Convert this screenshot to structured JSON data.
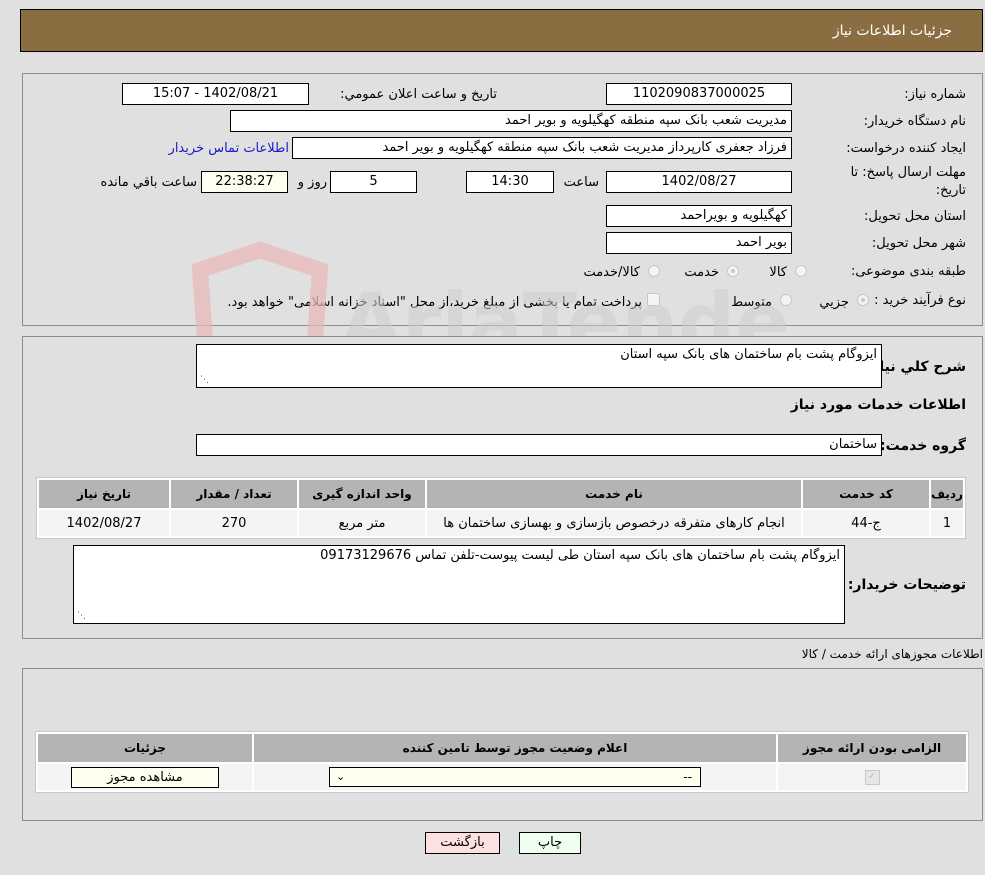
{
  "header": {
    "title": "جزئیات اطلاعات نیاز"
  },
  "form": {
    "need_number_label": "شماره نیاز:",
    "need_number": "1102090837000025",
    "announce_label": "تاریخ و ساعت اعلان عمومي:",
    "announce_value": "1402/08/21 - 15:07",
    "buyer_org_label": "نام دستگاه خريدار:",
    "buyer_org": "مديريت شعب بانک سپه منطقه کهگیلویه و بویر احمد",
    "creator_label": "ایجاد کننده درخواست:",
    "creator": "فرزاد جعفری کارپرداز مدیریت شعب بانک سپه منطقه کهگیلویه و بویر احمد",
    "contact_link": "اطلاعات تماس خريدار",
    "deadline_label_1": "مهلت ارسال پاسخ: تا",
    "deadline_label_2": "تاریخ:",
    "deadline_date": "1402/08/27",
    "time_label": "ساعت",
    "deadline_time": "14:30",
    "days_value": "5",
    "days_label": "روز و",
    "remaining_time": "22:38:27",
    "remaining_label": "ساعت باقي مانده",
    "province_label": "استان محل تحویل:",
    "province": "کهگیلویه و بویراحمد",
    "city_label": "شهر محل تحویل:",
    "city": "بویر احمد",
    "category_label": "طبقه بندی موضوعی:",
    "category_options": [
      {
        "label": "کالا",
        "checked": false
      },
      {
        "label": "خدمت",
        "checked": true
      },
      {
        "label": "کالا/خدمت",
        "checked": false
      }
    ],
    "process_label": "نوع فرآیند خرید :",
    "process_options": [
      {
        "label": "جزيي",
        "checked": true
      },
      {
        "label": "متوسط",
        "checked": false
      }
    ],
    "treasury_note": "پرداخت تمام یا بخشی از مبلغ خرید،از محل \"اسناد خزانه اسلامی\" خواهد بود."
  },
  "details": {
    "summary_label": "شرح کلي نياز:",
    "summary": "ایزوگام پشت بام ساختمان های بانک سپه استان",
    "services_heading": "اطلاعات خدمات مورد نياز",
    "service_group_label": "گروه خدمت:",
    "service_group": "ساختمان",
    "table": {
      "headers": [
        "رديف",
        "کد خدمت",
        "نام خدمت",
        "واحد اندازه گيری",
        "تعداد / مقدار",
        "تاریخ نیاز"
      ],
      "rows": [
        [
          "1",
          "ج-44",
          "انجام کارهای متفرقه درخصوص بازسازی و بهسازی ساختمان ها",
          "متر مربع",
          "270",
          "1402/08/27"
        ]
      ]
    },
    "buyer_notes_label": "توضیحات خریدار:",
    "buyer_notes": "ایزوگام پشت بام ساختمان های بانک سپه استان طی لیست پیوست-تلفن تماس 09173129676"
  },
  "permits": {
    "title": "اطلاعات مجوزهای ارائه خدمت / کالا",
    "headers": [
      "الزامی بودن ارائه مجوز",
      "اعلام وضعیت مجوز توسط تامین کننده",
      "جزئیات"
    ],
    "row": {
      "required": true,
      "status_value": "--",
      "view_button": "مشاهده مجوز"
    }
  },
  "footer": {
    "print_button": "چاپ",
    "back_button": "بازگشت"
  },
  "watermark": {
    "text": "AriaTender.neT"
  }
}
